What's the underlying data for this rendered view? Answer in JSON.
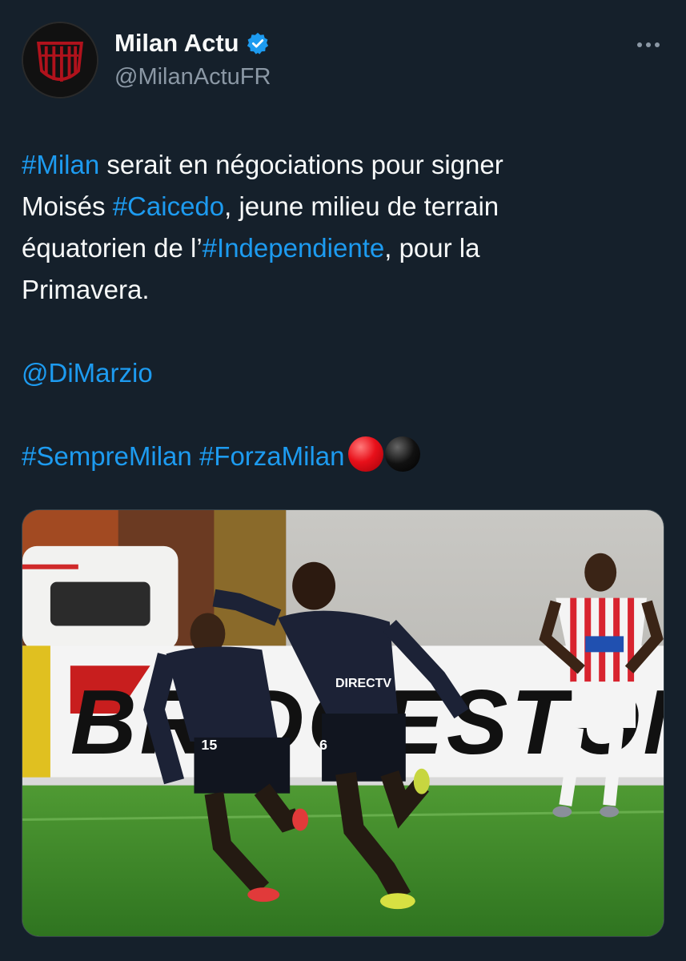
{
  "author": {
    "display_name": "Milan Actu",
    "handle": "@MilanActuFR",
    "verified_icon": "verified-badge-icon",
    "avatar_icon": "club-crest-icon"
  },
  "menu": {
    "icon": "more-options-icon"
  },
  "tweet": {
    "line1": {
      "tag_milan": "#Milan",
      "text1": " serait en négociations pour signer "
    },
    "line2": {
      "text2": "Moisés ",
      "tag_caicedo": "#Caicedo",
      "text3": ", jeune milieu de terrain"
    },
    "line3": {
      "text4": "équatorien de l’",
      "tag_independiente": "#Independiente",
      "text5": ", pour la"
    },
    "line4": {
      "text6": "Primavera."
    },
    "mention": "@DiMarzio",
    "tag_sempre": "#SempreMilan",
    "space": " ",
    "tag_forza": "#ForzaMilan",
    "emojis": [
      "red-circle",
      "black-circle"
    ]
  },
  "media": {
    "description_icon": "match-photo",
    "ad_board_text": "BRIDGESTONE",
    "sponsor_text": "DIRECTV",
    "colors": {
      "grass": "#3f8a2a",
      "kit_dark": "#1c2236",
      "kit_striped_red": "#d8242f"
    }
  },
  "colors": {
    "background": "#15202b",
    "link": "#1d9bf0",
    "secondary": "#8b98a5",
    "text": "#f7f9f9"
  }
}
